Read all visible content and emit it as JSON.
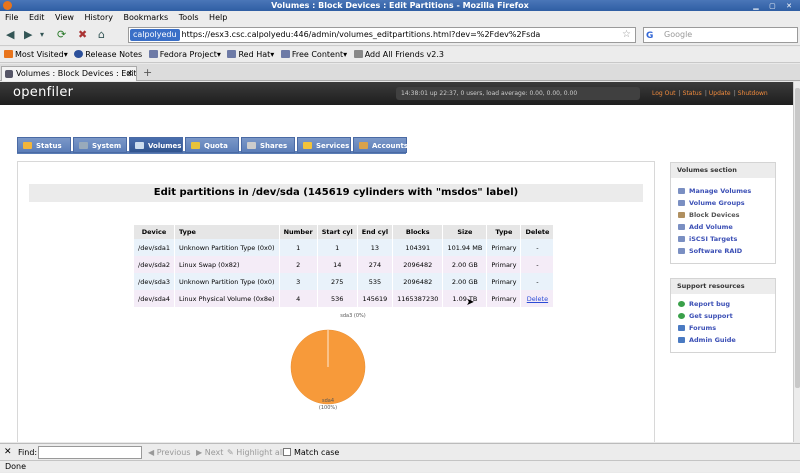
{
  "window": {
    "title": "Volumes : Block Devices : Edit Partitions - Mozilla Firefox"
  },
  "menu": [
    "File",
    "Edit",
    "View",
    "History",
    "Bookmarks",
    "Tools",
    "Help"
  ],
  "nav": {
    "site_label": "calpolyedu",
    "url": "https://esx3.csc.calpolyedu:446/admin/volumes_editpartitions.html?dev=%2Fdev%2Fsda",
    "search_placeholder": "Google"
  },
  "bookmarks": [
    {
      "label": "Most Visited",
      "color": "#e8741c"
    },
    {
      "label": "Release Notes",
      "color": "#2b4f9a"
    },
    {
      "label": "Fedora Project",
      "color": "#6d7aa6"
    },
    {
      "label": "Red Hat",
      "color": "#6d7aa6"
    },
    {
      "label": "Free Content",
      "color": "#6d7aa6"
    },
    {
      "label": "Add All Friends v2.3",
      "color": "#888888"
    }
  ],
  "tab": {
    "label": "Volumes : Block Devices : Edit Pa..."
  },
  "openfiler": {
    "logo": "openfiler",
    "sysinfo": "14:38:01 up 22:37, 0 users, load average: 0.00, 0.00, 0.00",
    "links": [
      "Log Out",
      "Status",
      "Update",
      "Shutdown"
    ],
    "nav_tabs": [
      {
        "label": "Status",
        "icon": "#f2b53a"
      },
      {
        "label": "System",
        "icon": "#9ab"
      },
      {
        "label": "Volumes",
        "icon": "#cde"
      },
      {
        "label": "Quota",
        "icon": "#e7c33a"
      },
      {
        "label": "Shares",
        "icon": "#ccc"
      },
      {
        "label": "Services",
        "icon": "#f2c33a"
      },
      {
        "label": "Accounts",
        "icon": "#d9a24a"
      }
    ],
    "active_tab": "Volumes"
  },
  "page": {
    "title": "Edit partitions in /dev/sda (145619 cylinders with \"msdos\" label)"
  },
  "table": {
    "headers": [
      "Device",
      "Type",
      "Number",
      "Start cyl",
      "End cyl",
      "Blocks",
      "Size",
      "Type",
      "Delete"
    ],
    "rows": [
      [
        "/dev/sda1",
        "Unknown Partition Type (0x0)",
        "1",
        "1",
        "13",
        "104391",
        "101.94 MB",
        "Primary",
        "-"
      ],
      [
        "/dev/sda2",
        "Linux Swap (0x82)",
        "2",
        "14",
        "274",
        "2096482",
        "2.00 GB",
        "Primary",
        "-"
      ],
      [
        "/dev/sda3",
        "Unknown Partition Type (0x0)",
        "3",
        "275",
        "535",
        "2096482",
        "2.00 GB",
        "Primary",
        "-"
      ],
      [
        "/dev/sda4",
        "Linux Physical Volume (0x8e)",
        "4",
        "536",
        "145619",
        "1165387230",
        "1.09 TB",
        "Primary",
        "Delete"
      ]
    ]
  },
  "pie": {
    "top_label": "sda3 (0%)",
    "bottom_label": "sda4",
    "bottom_pct": "(100%)",
    "color": "#f79a3a",
    "share": 1.0
  },
  "sidebar": {
    "volumes_title": "Volumes section",
    "volumes_items": [
      {
        "label": "Manage Volumes",
        "icon": "#7a8fc2"
      },
      {
        "label": "Volume Groups",
        "icon": "#7a8fc2"
      },
      {
        "label": "Block Devices",
        "icon": "#b09060"
      },
      {
        "label": "Add Volume",
        "icon": "#7a8fc2"
      },
      {
        "label": "iSCSI Targets",
        "icon": "#7a8fc2"
      },
      {
        "label": "Software RAID",
        "icon": "#7a8fc2"
      }
    ],
    "support_title": "Support resources",
    "support_items": [
      {
        "label": "Report bug",
        "icon": "#3aa04a"
      },
      {
        "label": "Get support",
        "icon": "#3aa04a"
      },
      {
        "label": "Forums",
        "icon": "#4a7ac2"
      },
      {
        "label": "Admin Guide",
        "icon": "#4a7ac2"
      }
    ]
  },
  "findbar": {
    "label": "Find:",
    "previous": "Previous",
    "next": "Next",
    "highlight": "Highlight all",
    "match_case": "Match case"
  },
  "status": "Done"
}
